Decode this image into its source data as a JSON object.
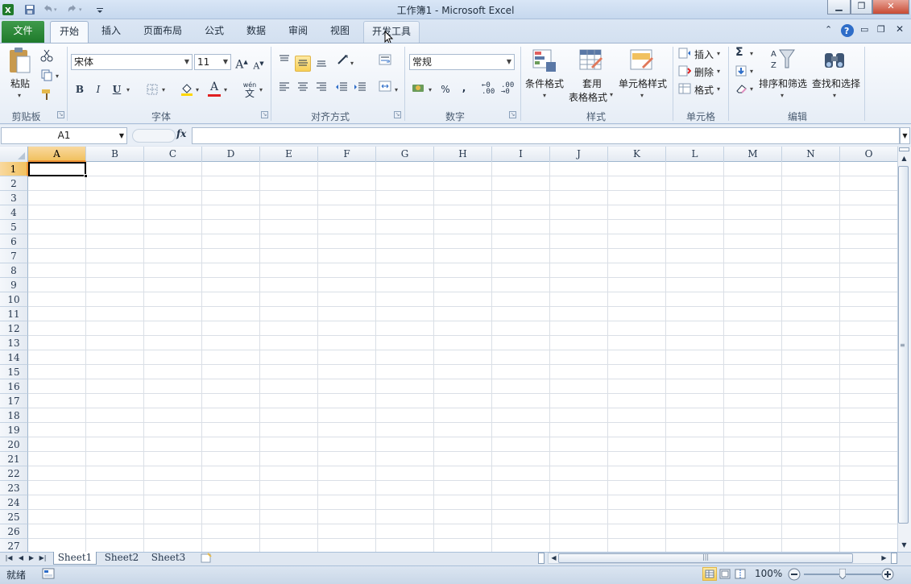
{
  "window": {
    "title": "工作簿1  -  Microsoft Excel",
    "minimize_icon": "minimize-icon",
    "maximize_icon": "restore-icon",
    "close_icon": "close-icon"
  },
  "quick_access": [
    "excel-logo-icon",
    "save-icon",
    "undo-icon",
    "redo-icon",
    "customize-icon"
  ],
  "tabs": [
    {
      "label": "文件"
    },
    {
      "label": "开始"
    },
    {
      "label": "插入"
    },
    {
      "label": "页面布局"
    },
    {
      "label": "公式"
    },
    {
      "label": "数据"
    },
    {
      "label": "审阅"
    },
    {
      "label": "视图"
    },
    {
      "label": "开发工具"
    }
  ],
  "ribbon": {
    "clipboard": {
      "label": "剪贴板",
      "paste": "粘贴"
    },
    "font": {
      "label": "字体",
      "font_name": "宋体",
      "font_size": "11",
      "bold": "B",
      "italic": "I",
      "underline": "U",
      "grow": "A",
      "shrink": "A",
      "font_color": "A",
      "phonetic": "wén",
      "phonetic_char": "文"
    },
    "alignment": {
      "label": "对齐方式"
    },
    "number": {
      "label": "数字",
      "format": "常规",
      "percent": "%",
      "comma": ","
    },
    "styles": {
      "label": "样式",
      "conditional": "条件格式",
      "table_line1": "套用",
      "table_line2": "表格格式",
      "cell_styles": "单元格样式"
    },
    "cells": {
      "label": "单元格",
      "insert": "插入",
      "delete": "删除",
      "format": "格式"
    },
    "editing": {
      "label": "编辑",
      "sum": "Σ",
      "sort_filter": "排序和筛选",
      "find_select": "查找和选择"
    }
  },
  "formula_bar": {
    "name_box": "A1",
    "fx": "fx",
    "value": ""
  },
  "grid": {
    "columns": [
      "A",
      "B",
      "C",
      "D",
      "E",
      "F",
      "G",
      "H",
      "I",
      "J",
      "K",
      "L",
      "M",
      "N",
      "O"
    ],
    "rows": [
      "1",
      "2",
      "3",
      "4",
      "5",
      "6",
      "7",
      "8",
      "9",
      "10",
      "11",
      "12",
      "13",
      "14",
      "15",
      "16",
      "17",
      "18",
      "19",
      "20",
      "21",
      "22",
      "23",
      "24",
      "25",
      "26",
      "27"
    ],
    "active_cell": "A1"
  },
  "sheets": {
    "tabs": [
      "Sheet1",
      "Sheet2",
      "Sheet3"
    ],
    "active": "Sheet1"
  },
  "status": {
    "ready": "就绪",
    "zoom": "100%",
    "zoom_level": 1.0
  },
  "colors": {
    "file_tab": "#2a8638",
    "selection_header": "#f1c15f",
    "accent": "#f29536"
  }
}
